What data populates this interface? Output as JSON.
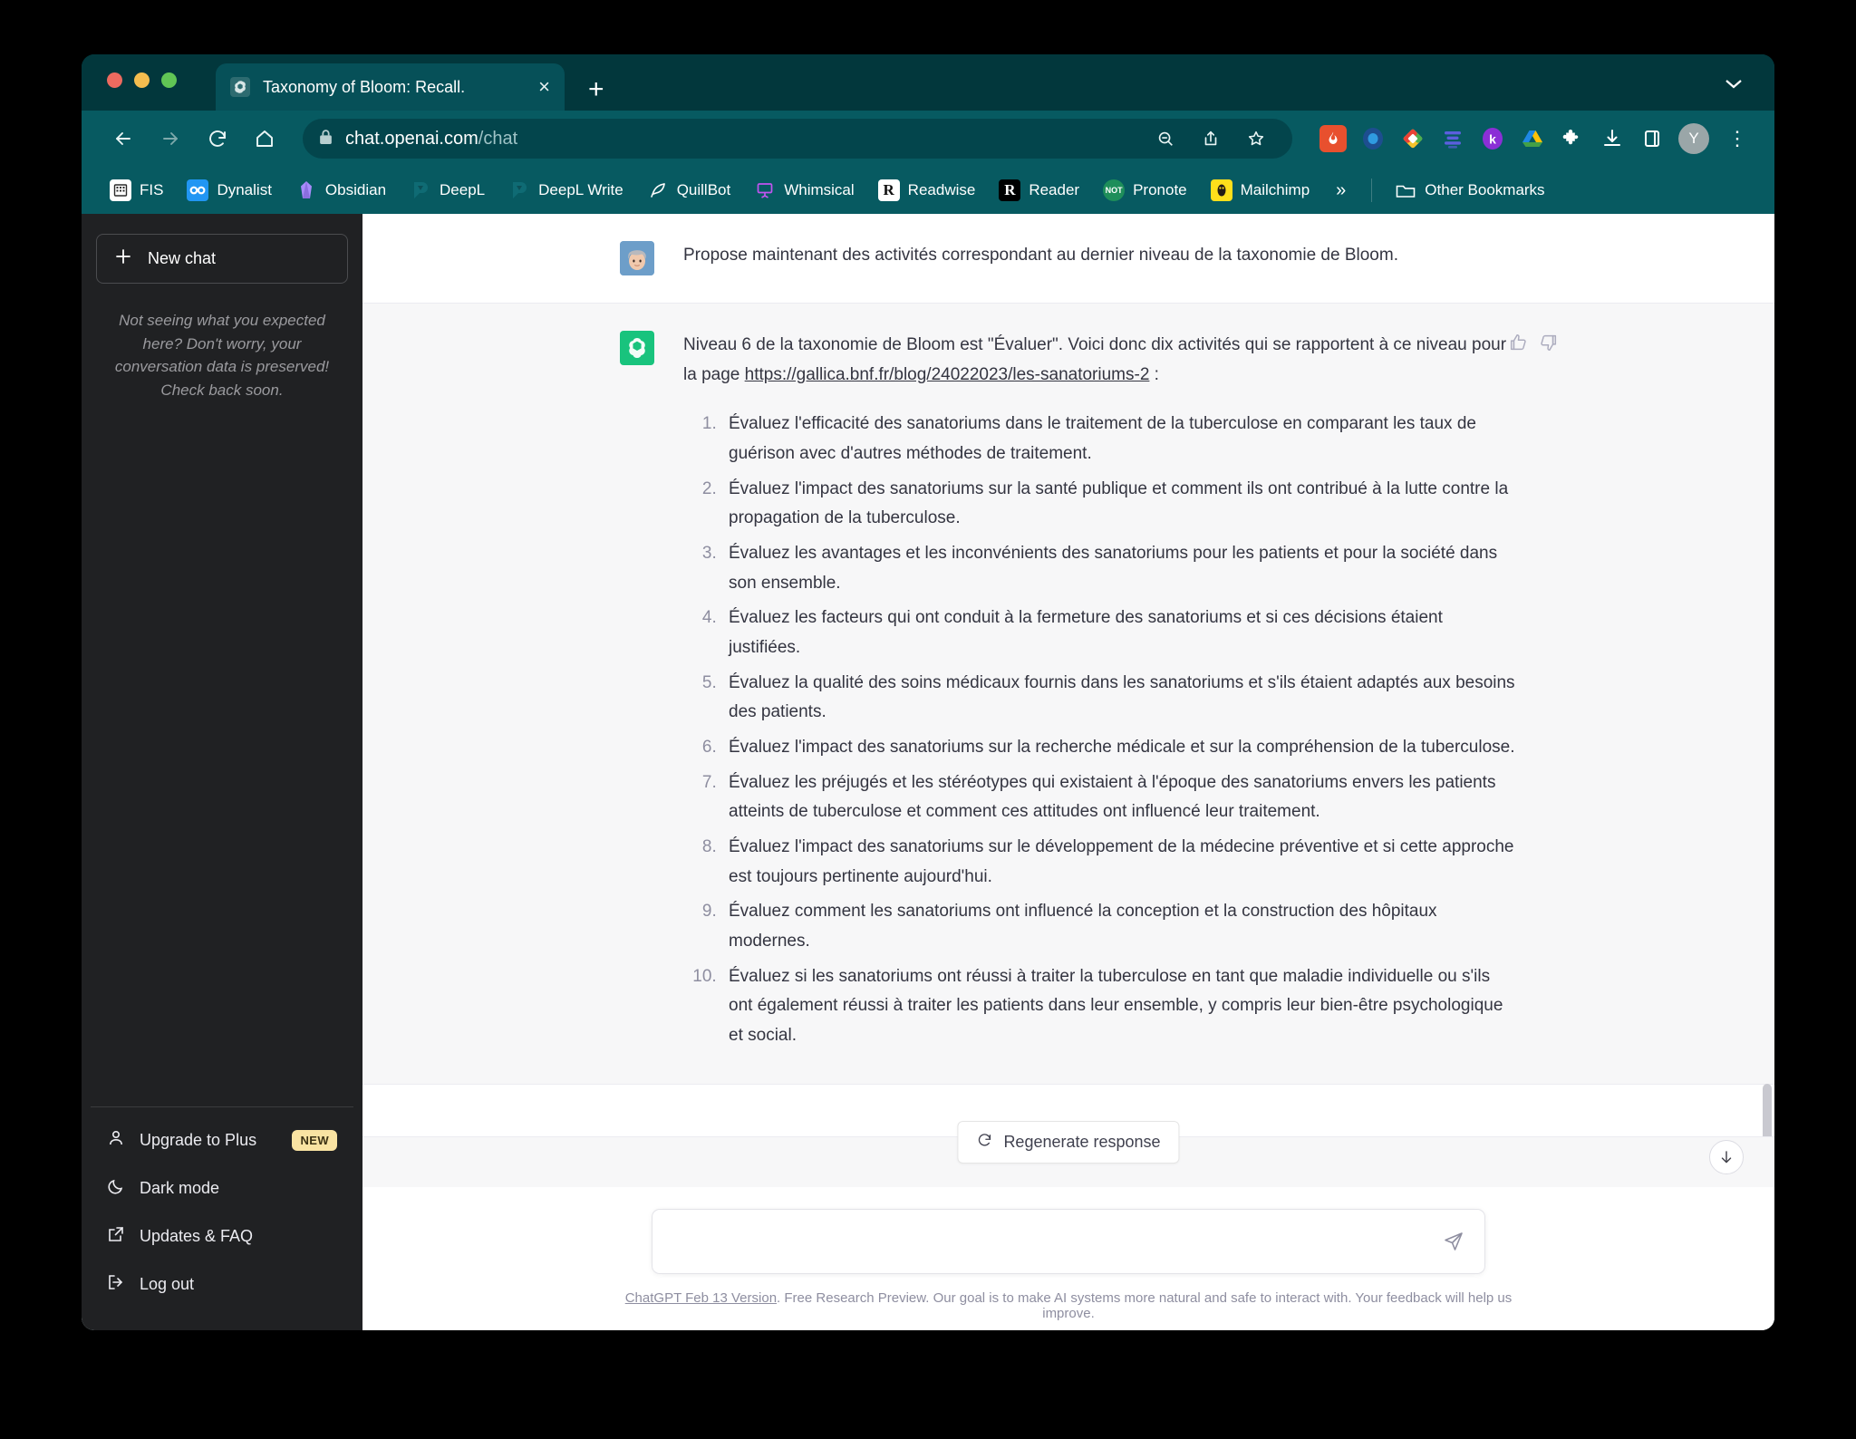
{
  "browser": {
    "tab": {
      "title": "Taxonomy of Bloom: Recall.",
      "favicon": "openai-icon",
      "close": "×"
    },
    "new_tab_label": "+",
    "tabstrip_chevron": "chevron-down-icon",
    "nav": {
      "back": "←",
      "forward": "→",
      "reload": "⟳",
      "home": "⌂"
    },
    "omnibox": {
      "lock": "lock-icon",
      "domain": "chat.openai.com",
      "path": "/chat"
    },
    "omni_actions": [
      "zoom-out-icon",
      "share-icon",
      "bookmark-star-icon"
    ],
    "extensions": [
      {
        "name": "fireshot-extension",
        "label": "🔥",
        "color": "#e8502e"
      },
      {
        "name": "blue-circle-extension",
        "label": "",
        "color": "#2f6fb8"
      },
      {
        "name": "evernote-web-clipper-extension",
        "label": "",
        "color": "#ffffff"
      },
      {
        "name": "lines-extension",
        "label": "",
        "color": "#5b5fde"
      },
      {
        "name": "kortex-extension",
        "label": "k",
        "color": "#8b2fd6"
      },
      {
        "name": "google-drive-extension",
        "label": "",
        "color": "#ffffff"
      },
      {
        "name": "puzzle-extensions-icon",
        "label": "",
        "color": "#ffffff"
      },
      {
        "name": "download-icon",
        "label": "",
        "color": "#ffffff"
      },
      {
        "name": "side-panel-icon",
        "label": "",
        "color": "#ffffff"
      }
    ],
    "profile_initial": "Y",
    "menu": "kebab-menu-icon",
    "bookmarks": [
      {
        "label": "FIS",
        "icon": "building-icon",
        "bg": "#ffffff",
        "fg": "#2b2b2b"
      },
      {
        "label": "Dynalist",
        "icon": "infinity-icon",
        "bg": "#2196f3",
        "fg": "#ffffff"
      },
      {
        "label": "Obsidian",
        "icon": "obsidian-gem-icon",
        "bg": "transparent",
        "fg": "#a78bfa"
      },
      {
        "label": "DeepL",
        "icon": "deepl-icon",
        "bg": "transparent",
        "fg": "#0f6b74"
      },
      {
        "label": "DeepL Write",
        "icon": "deepl-icon",
        "bg": "transparent",
        "fg": "#0f6b74"
      },
      {
        "label": "QuillBot",
        "icon": "quill-icon",
        "bg": "transparent",
        "fg": "#e8e8e8"
      },
      {
        "label": "Whimsical",
        "icon": "whimsical-board-icon",
        "bg": "transparent",
        "fg": "#a855f7"
      },
      {
        "label": "Readwise",
        "icon": "readwise-r-icon",
        "bg": "#ffffff",
        "fg": "#111111"
      },
      {
        "label": "Reader",
        "icon": "reader-r-icon",
        "bg": "#000000",
        "fg": "#ffffff"
      },
      {
        "label": "Pronote",
        "icon": "pronote-icon",
        "bg": "#1e8e5a",
        "fg": "#ffffff"
      },
      {
        "label": "Mailchimp",
        "icon": "mailchimp-icon",
        "bg": "#ffe01b",
        "fg": "#241c15"
      }
    ],
    "bookmarks_overflow": "»",
    "other_bookmarks": {
      "label": "Other Bookmarks",
      "icon": "folder-icon"
    }
  },
  "sidebar": {
    "new_chat": {
      "label": "New chat",
      "icon": "plus-icon"
    },
    "note": "Not seeing what you expected here? Don't worry, your conversation data is preserved! Check back soon.",
    "items": [
      {
        "label": "Upgrade to Plus",
        "icon": "person-icon",
        "badge": "NEW"
      },
      {
        "label": "Dark mode",
        "icon": "moon-icon",
        "badge": ""
      },
      {
        "label": "Updates & FAQ",
        "icon": "external-link-icon",
        "badge": ""
      },
      {
        "label": "Log out",
        "icon": "logout-icon",
        "badge": ""
      }
    ]
  },
  "conversation": {
    "user_message": "Propose maintenant des activités correspondant au dernier niveau de la taxonomie de Bloom.",
    "assistant": {
      "intro_before_link": "Niveau 6 de la taxonomie de Bloom est \"Évaluer\". Voici donc dix activités qui se rapportent à ce niveau pour la page ",
      "link_text": "https://gallica.bnf.fr/blog/24022023/les-sanatoriums-2",
      "intro_after_link": " :",
      "items": [
        "Évaluez l'efficacité des sanatoriums dans le traitement de la tuberculose en comparant les taux de guérison avec d'autres méthodes de traitement.",
        "Évaluez l'impact des sanatoriums sur la santé publique et comment ils ont contribué à la lutte contre la propagation de la tuberculose.",
        "Évaluez les avantages et les inconvénients des sanatoriums pour les patients et pour la société dans son ensemble.",
        "Évaluez les facteurs qui ont conduit à la fermeture des sanatoriums et si ces décisions étaient justifiées.",
        "Évaluez la qualité des soins médicaux fournis dans les sanatoriums et s'ils étaient adaptés aux besoins des patients.",
        "Évaluez l'impact des sanatoriums sur la recherche médicale et sur la compréhension de la tuberculose.",
        "Évaluez les préjugés et les stéréotypes qui existaient à l'époque des sanatoriums envers les patients atteints de tuberculose et comment ces attitudes ont influencé leur traitement.",
        "Évaluez l'impact des sanatoriums sur le développement de la médecine préventive et si cette approche est toujours pertinente aujourd'hui.",
        "Évaluez comment les sanatoriums ont influencé la conception et la construction des hôpitaux modernes.",
        "Évaluez si les sanatoriums ont réussi à traiter la tuberculose en tant que maladie individuelle ou s'ils ont également réussi à traiter les patients dans leur ensemble, y compris leur bien-être psychologique et social."
      ],
      "rate_up": "thumbs-up-icon",
      "rate_down": "thumbs-down-icon"
    }
  },
  "actions": {
    "regenerate": {
      "label": "Regenerate response",
      "icon": "refresh-icon"
    },
    "scroll_to_bottom": "arrow-down-icon"
  },
  "composer": {
    "value": "",
    "placeholder": "",
    "send_icon": "send-icon"
  },
  "footer": {
    "version_link": "ChatGPT Feb 13 Version",
    "text": ". Free Research Preview. Our goal is to make AI systems more natural and safe to interact with. Your feedback will help us improve."
  },
  "colors": {
    "browser_chrome": "#075a61",
    "tabstrip": "#02373c",
    "sidebar": "#202123",
    "accent_green": "#19c37d",
    "badge_new": "#f9e3a2"
  }
}
